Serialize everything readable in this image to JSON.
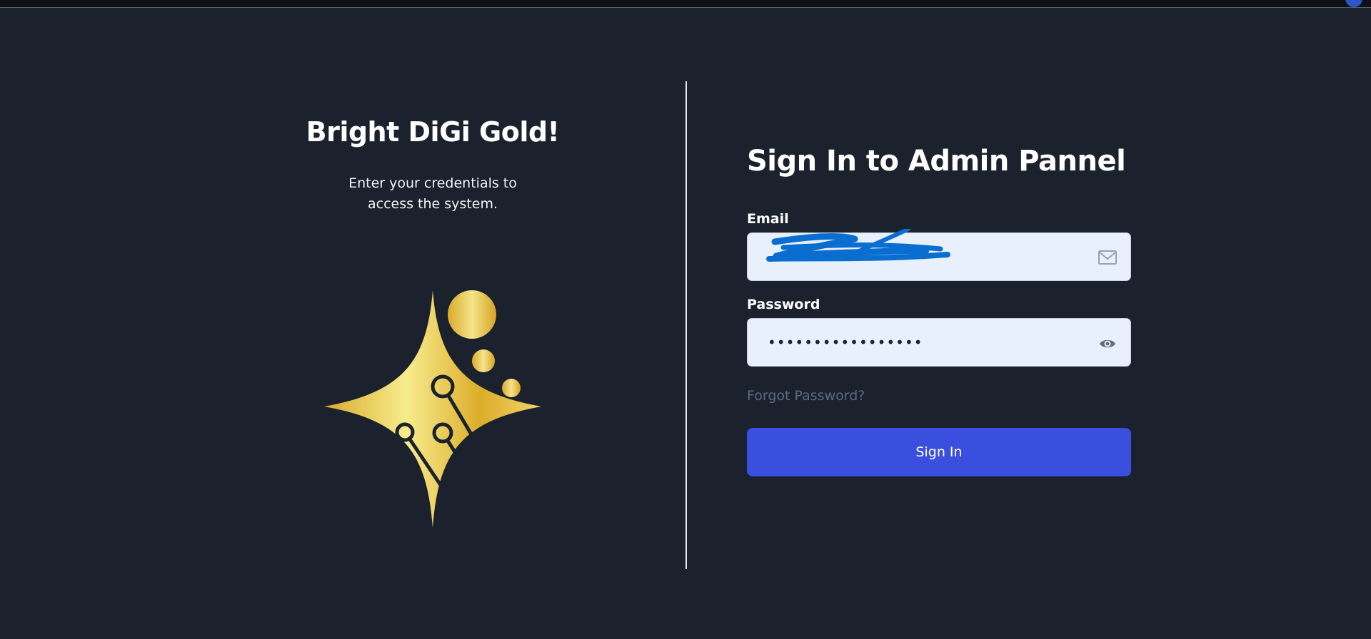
{
  "brand": {
    "title": "Bright DiGi Gold!",
    "subtitle": "Enter your credentials to access the system.",
    "logo_icon": "gold-sparkle-circuit-logo",
    "logo_colors": {
      "gold_light": "#f7ec8d",
      "gold_mid": "#e8c547",
      "gold_dark": "#d8a826",
      "circuit": "#1b222d"
    }
  },
  "form": {
    "heading": "Sign In to Admin Pannel",
    "email": {
      "label": "Email",
      "value": "",
      "icon": "mail-icon",
      "redaction_color": "#0a6ed1"
    },
    "password": {
      "label": "Password",
      "value": "•••••••••••••••••",
      "icon": "eye-icon"
    },
    "forgot_label": "Forgot Password?",
    "submit_label": "Sign In"
  },
  "theme": {
    "background": "#1b222d",
    "input_background": "#e8f0fe",
    "accent": "#3b4fdf",
    "muted_link": "#5c6a81"
  }
}
